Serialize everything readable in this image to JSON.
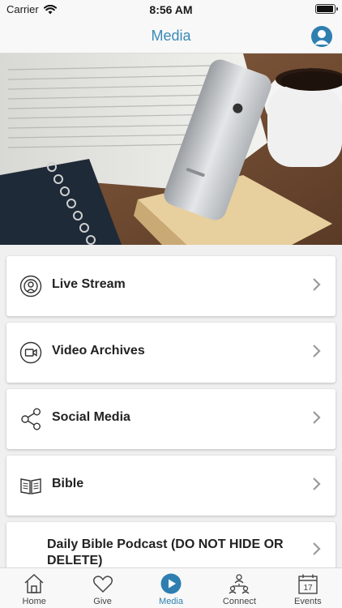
{
  "status_bar": {
    "carrier": "Carrier",
    "time": "8:56 AM",
    "battery_level": 0.95
  },
  "nav": {
    "title": "Media"
  },
  "hero": {
    "image_description": "open book, smartphone on wooden stand, coffee cup, spiral notebook"
  },
  "menu": [
    {
      "label": "Live Stream",
      "icon": "live-stream-icon"
    },
    {
      "label": "Video Archives",
      "icon": "video-camera-icon"
    },
    {
      "label": "Social Media",
      "icon": "share-icon"
    },
    {
      "label": "Bible",
      "icon": "book-icon"
    },
    {
      "label": "Daily Bible Podcast (DO NOT HIDE OR DELETE)",
      "icon": ""
    }
  ],
  "tabs": [
    {
      "label": "Home",
      "icon": "home-icon"
    },
    {
      "label": "Give",
      "icon": "heart-icon"
    },
    {
      "label": "Media",
      "icon": "play-icon",
      "active": true
    },
    {
      "label": "Connect",
      "icon": "people-icon"
    },
    {
      "label": "Events",
      "icon": "calendar-icon",
      "date": "17"
    }
  ],
  "colors": {
    "accent": "#2e7fb0",
    "nav_title": "#3a8ab5"
  }
}
